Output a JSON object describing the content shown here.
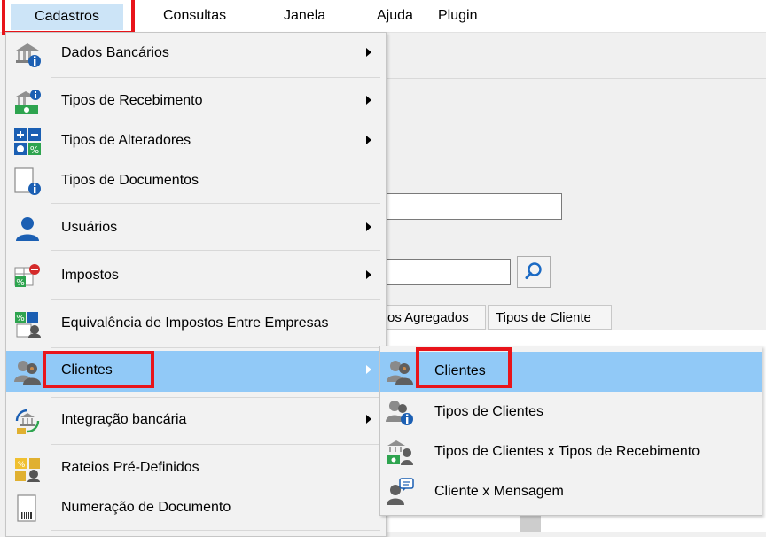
{
  "menubar": {
    "items": [
      "Cadastros",
      "Consultas",
      "Janela",
      "Ajuda",
      "Plugin"
    ]
  },
  "background": {
    "tabs": [
      "os Agregados",
      "Tipos de Cliente"
    ]
  },
  "dropdown": {
    "items": [
      {
        "label": "Dados Bancários",
        "icon": "bank-info-icon",
        "submenu": true
      },
      {
        "label": "Tipos de Recebimento",
        "icon": "money-info-icon",
        "submenu": true
      },
      {
        "label": "Tipos de Alteradores",
        "icon": "calculator-icon",
        "submenu": true
      },
      {
        "label": "Tipos de Documentos",
        "icon": "document-info-icon",
        "submenu": false
      },
      {
        "label": "Usuários",
        "icon": "user-icon",
        "submenu": true
      },
      {
        "label": "Impostos",
        "icon": "tax-icon",
        "submenu": true
      },
      {
        "label": "Equivalência de Impostos Entre Empresas",
        "icon": "tax-equivalence-icon",
        "submenu": false
      },
      {
        "label": "Clientes",
        "icon": "clients-icon",
        "submenu": true
      },
      {
        "label": "Integração bancária",
        "icon": "bank-integration-icon",
        "submenu": true
      },
      {
        "label": "Rateios Pré-Definidos",
        "icon": "apportionment-icon",
        "submenu": false
      },
      {
        "label": "Numeração de Documento",
        "icon": "barcode-document-icon",
        "submenu": false
      }
    ]
  },
  "submenu": {
    "items": [
      {
        "label": "Clientes",
        "icon": "clients-icon"
      },
      {
        "label": "Tipos de Clientes",
        "icon": "client-types-icon"
      },
      {
        "label": "Tipos de Clientes x Tipos de Recebimento",
        "icon": "client-receipt-types-icon"
      },
      {
        "label": "Cliente x Mensagem",
        "icon": "client-message-icon"
      }
    ]
  },
  "colors": {
    "highlight_red": "#e8141a",
    "selected_blue": "#91c9f7",
    "menubar_active": "#cce4f7"
  }
}
